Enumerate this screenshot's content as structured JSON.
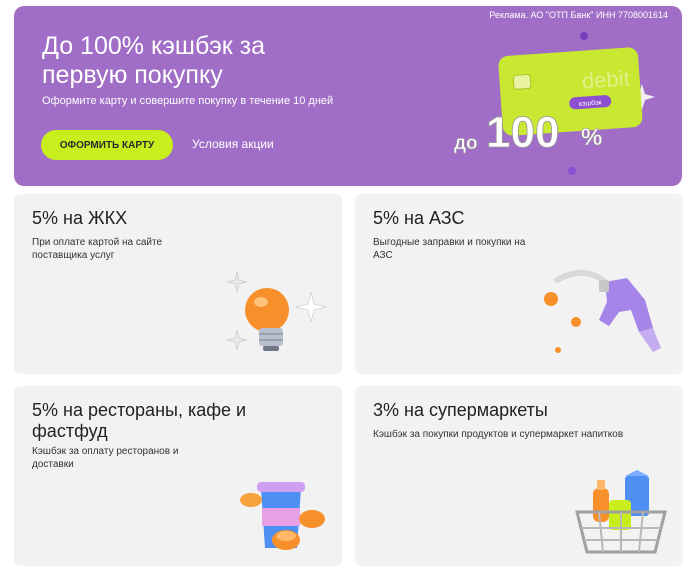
{
  "banner": {
    "ad_note": "Реклама. АО \"ОТП Банк\" ИНН 7708001614",
    "title": "До 100% кэшбэк за первую покупку",
    "subtitle": "Оформите карту и совершите покупку в течение 10 дней",
    "cta_label": "ОФОРМИТЬ КАРТУ",
    "terms_label": "Условия акции",
    "card_brand": "debit",
    "card_tag": "кэшбэк",
    "promo_prefix": "до",
    "promo_value": "100",
    "promo_percent": "%",
    "colors": {
      "background": "#a06ec6",
      "accent": "#c9ee1e"
    }
  },
  "cards": [
    {
      "title": "5% на ЖКХ",
      "description": "При оплате картой на сайте поставщика услуг",
      "icon": "lightbulb-icon"
    },
    {
      "title": "5% на АЗС",
      "description": "Выгодные заправки и покупки на АЗС",
      "icon": "fuel-nozzle-icon"
    },
    {
      "title": "5% на рестораны, кафе и фастфуд",
      "description": "Кэшбэк за оплату ресторанов и доставки",
      "icon": "coffee-cup-icon"
    },
    {
      "title": "3% на супермаркеты",
      "description": "Кэшбэк за покупки продуктов и супермаркет напитков",
      "icon": "shopping-basket-icon"
    }
  ]
}
